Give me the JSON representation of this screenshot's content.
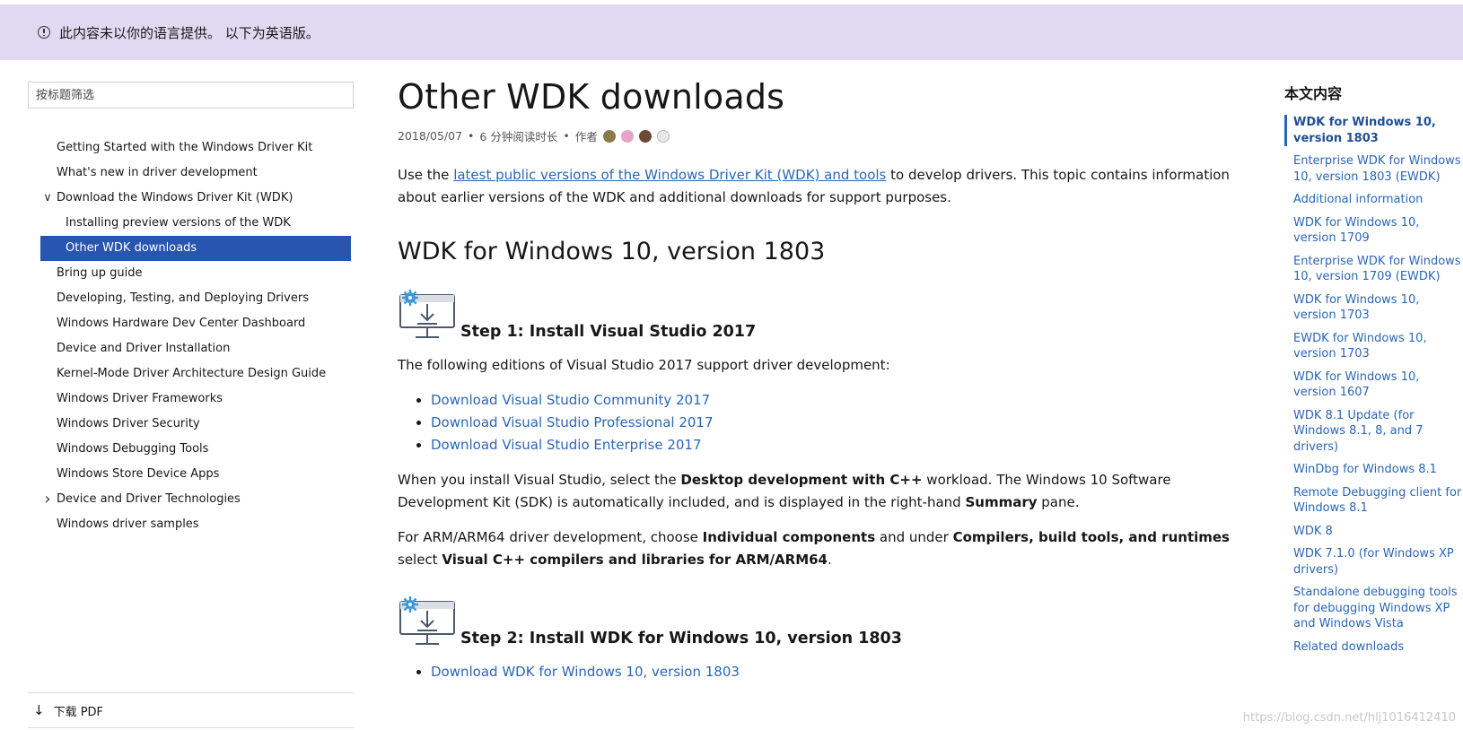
{
  "banner": {
    "text": "此内容未以你的语言提供。 以下为英语版。"
  },
  "sidebar": {
    "filter_placeholder": "按标题筛选",
    "items": [
      {
        "label": "Getting Started with the Windows Driver Kit"
      },
      {
        "label": "What's new in driver development"
      },
      {
        "label": "Download the Windows Driver Kit (WDK)"
      },
      {
        "label": "Installing preview versions of the WDK"
      },
      {
        "label": "Other WDK downloads"
      },
      {
        "label": "Bring up guide"
      },
      {
        "label": "Developing, Testing, and Deploying Drivers"
      },
      {
        "label": "Windows Hardware Dev Center Dashboard"
      },
      {
        "label": "Device and Driver Installation"
      },
      {
        "label": "Kernel-Mode Driver Architecture Design Guide"
      },
      {
        "label": "Windows Driver Frameworks"
      },
      {
        "label": "Windows Driver Security"
      },
      {
        "label": "Windows Debugging Tools"
      },
      {
        "label": "Windows Store Device Apps"
      },
      {
        "label": "Device and Driver Technologies"
      },
      {
        "label": "Windows driver samples"
      }
    ],
    "download_pdf": "下载 PDF"
  },
  "article": {
    "title": "Other WDK downloads",
    "date": "2018/05/07",
    "read_time": "6 分钟阅读时长",
    "author_label": "作者",
    "intro_before": "Use the ",
    "intro_link": "latest public versions of the Windows Driver Kit (WDK) and tools",
    "intro_after": " to develop drivers. This topic contains information about earlier versions of the WDK and additional downloads for support purposes.",
    "section_title": "WDK for Windows 10, version 1803",
    "step1_title": "Step 1: Install Visual Studio 2017",
    "step1_text": "The following editions of Visual Studio 2017 support driver development:",
    "vs_links": [
      "Download Visual Studio Community 2017",
      "Download Visual Studio Professional 2017",
      "Download Visual Studio Enterprise 2017"
    ],
    "p2_a": "When you install Visual Studio, select the ",
    "p2_b": "Desktop development with C++",
    "p2_c": " workload. The Windows 10 Software Development Kit (SDK) is automatically included, and is displayed in the right-hand ",
    "p2_d": "Summary",
    "p2_e": " pane.",
    "p3_a": "For ARM/ARM64 driver development, choose ",
    "p3_b": "Individual components",
    "p3_c": " and under ",
    "p3_d": "Compilers, build tools, and runtimes",
    "p3_e": " select ",
    "p3_f": "Visual C++ compilers and libraries for ARM/ARM64",
    "p3_g": ".",
    "step2_title": "Step 2: Install WDK for Windows 10, version 1803",
    "wdk_link": "Download WDK for Windows 10, version 1803"
  },
  "right_toc": {
    "heading": "本文内容",
    "links": [
      "WDK for Windows 10, version 1803",
      "Enterprise WDK for Windows 10, version 1803 (EWDK)",
      "Additional information",
      "WDK for Windows 10, version 1709",
      "Enterprise WDK for Windows 10, version 1709 (EWDK)",
      "WDK for Windows 10, version 1703",
      "EWDK for Windows 10, version 1703",
      "WDK for Windows 10, version 1607",
      "WDK 8.1 Update (for Windows 8.1, 8, and 7 drivers)",
      "WinDbg for Windows 8.1",
      "Remote Debugging client for Windows 8.1",
      "WDK 8",
      "WDK 7.1.0 (for Windows XP drivers)",
      "Standalone debugging tools for debugging Windows XP and Windows Vista",
      "Related downloads"
    ]
  },
  "watermark": "https://blog.csdn.net/hlj1016412410",
  "colors": {
    "banner_bg": "#e0d9f1",
    "selected_bg": "#2755b0",
    "link": "#2a66b6"
  }
}
